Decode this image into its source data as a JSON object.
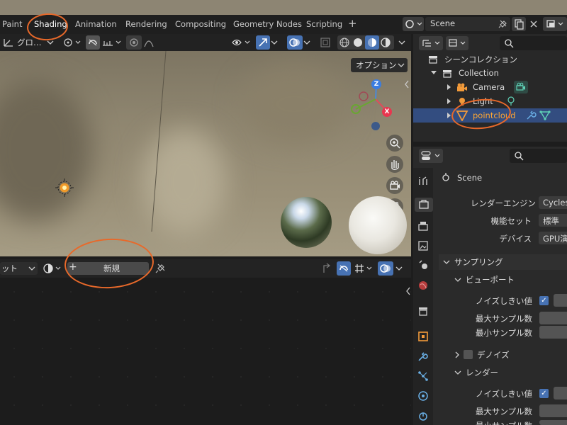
{
  "workspace_tabs": [
    {
      "label": "Paint"
    },
    {
      "label": "Shading",
      "active": true
    },
    {
      "label": "Animation"
    },
    {
      "label": "Rendering"
    },
    {
      "label": "Compositing"
    },
    {
      "label": "Geometry Nodes"
    },
    {
      "label": "Scripting"
    }
  ],
  "add_workspace_icon": "+",
  "scene_selector": {
    "value": "Scene"
  },
  "viewport": {
    "transform_orientation": "グロ…",
    "options_label": "オプション",
    "gizmo": {
      "z_label": "Z",
      "x_label": "X"
    }
  },
  "node_editor": {
    "slot_label": "ット",
    "new_button": "新規",
    "new_plus_icon": "+"
  },
  "outliner": {
    "root": "シーンコレクション",
    "collection": "Collection",
    "items": [
      {
        "label": "Camera"
      },
      {
        "label": "Light"
      },
      {
        "label": "pointcloud",
        "selected": true
      }
    ]
  },
  "properties": {
    "breadcrumb": "Scene",
    "render_engine_label": "レンダーエンジン",
    "render_engine_value": "Cycles",
    "feature_set_label": "機能セット",
    "feature_set_value": "標準",
    "device_label": "デバイス",
    "device_value": "GPU演",
    "sampling_header": "サンプリング",
    "viewport_header": "ビューポート",
    "noise_threshold_label": "ノイズしきい値",
    "max_samples_label": "最大サンプル数",
    "min_samples_label": "最小サンプル数",
    "denoise_header": "デノイズ",
    "render_header": "レンダー",
    "render_noise_threshold_label": "ノイズしきい値",
    "render_max_samples_label": "最大サンプル数",
    "render_min_samples_label": "最小サンプル数"
  },
  "colors": {
    "accent": "#4772b3",
    "annotation": "#e8692a",
    "selected_row": "#334d80",
    "selected_text": "#ffa733"
  }
}
